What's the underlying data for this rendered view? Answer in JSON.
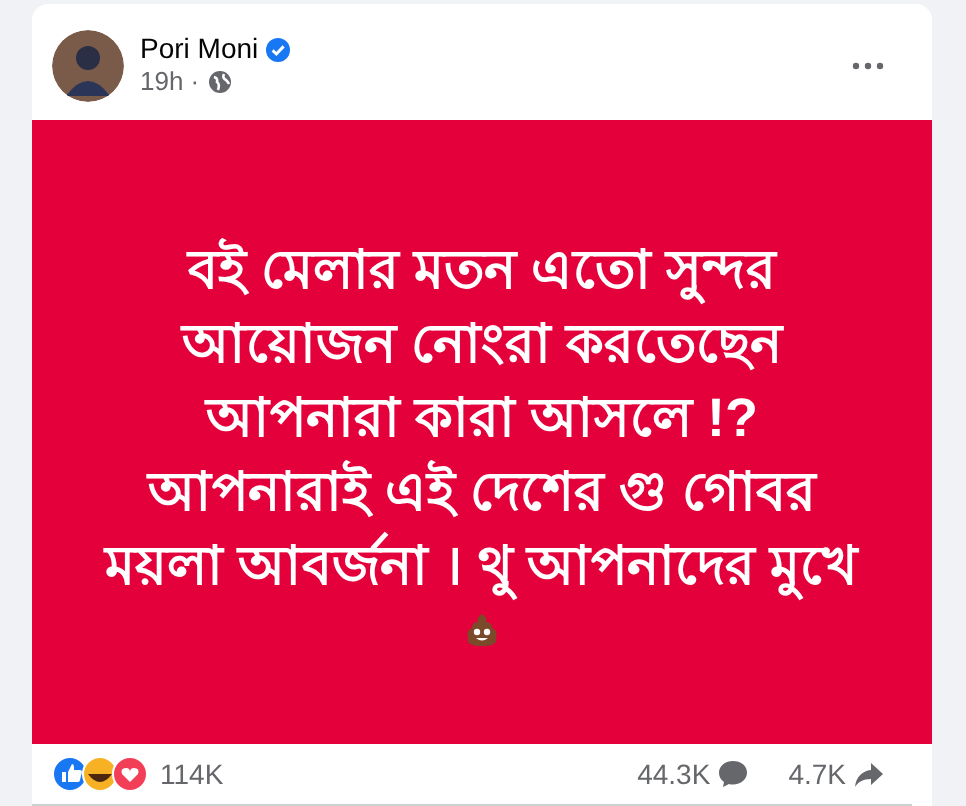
{
  "post": {
    "author": "Pori Moni",
    "verified": true,
    "time": "19h ·",
    "lines": [
      "বই মেলার মতন এতো সুন্দর",
      "আয়োজন নোংরা করতেছেন",
      "আপনারা কারা আসলে !?",
      "আপনারাই এই দেশের গু গোবর",
      "ময়লা আবর্জনা । থু আপনাদের মুখে"
    ],
    "reactions_count": "114K",
    "comments_count": "44.3K",
    "shares_count": "4.7K"
  }
}
